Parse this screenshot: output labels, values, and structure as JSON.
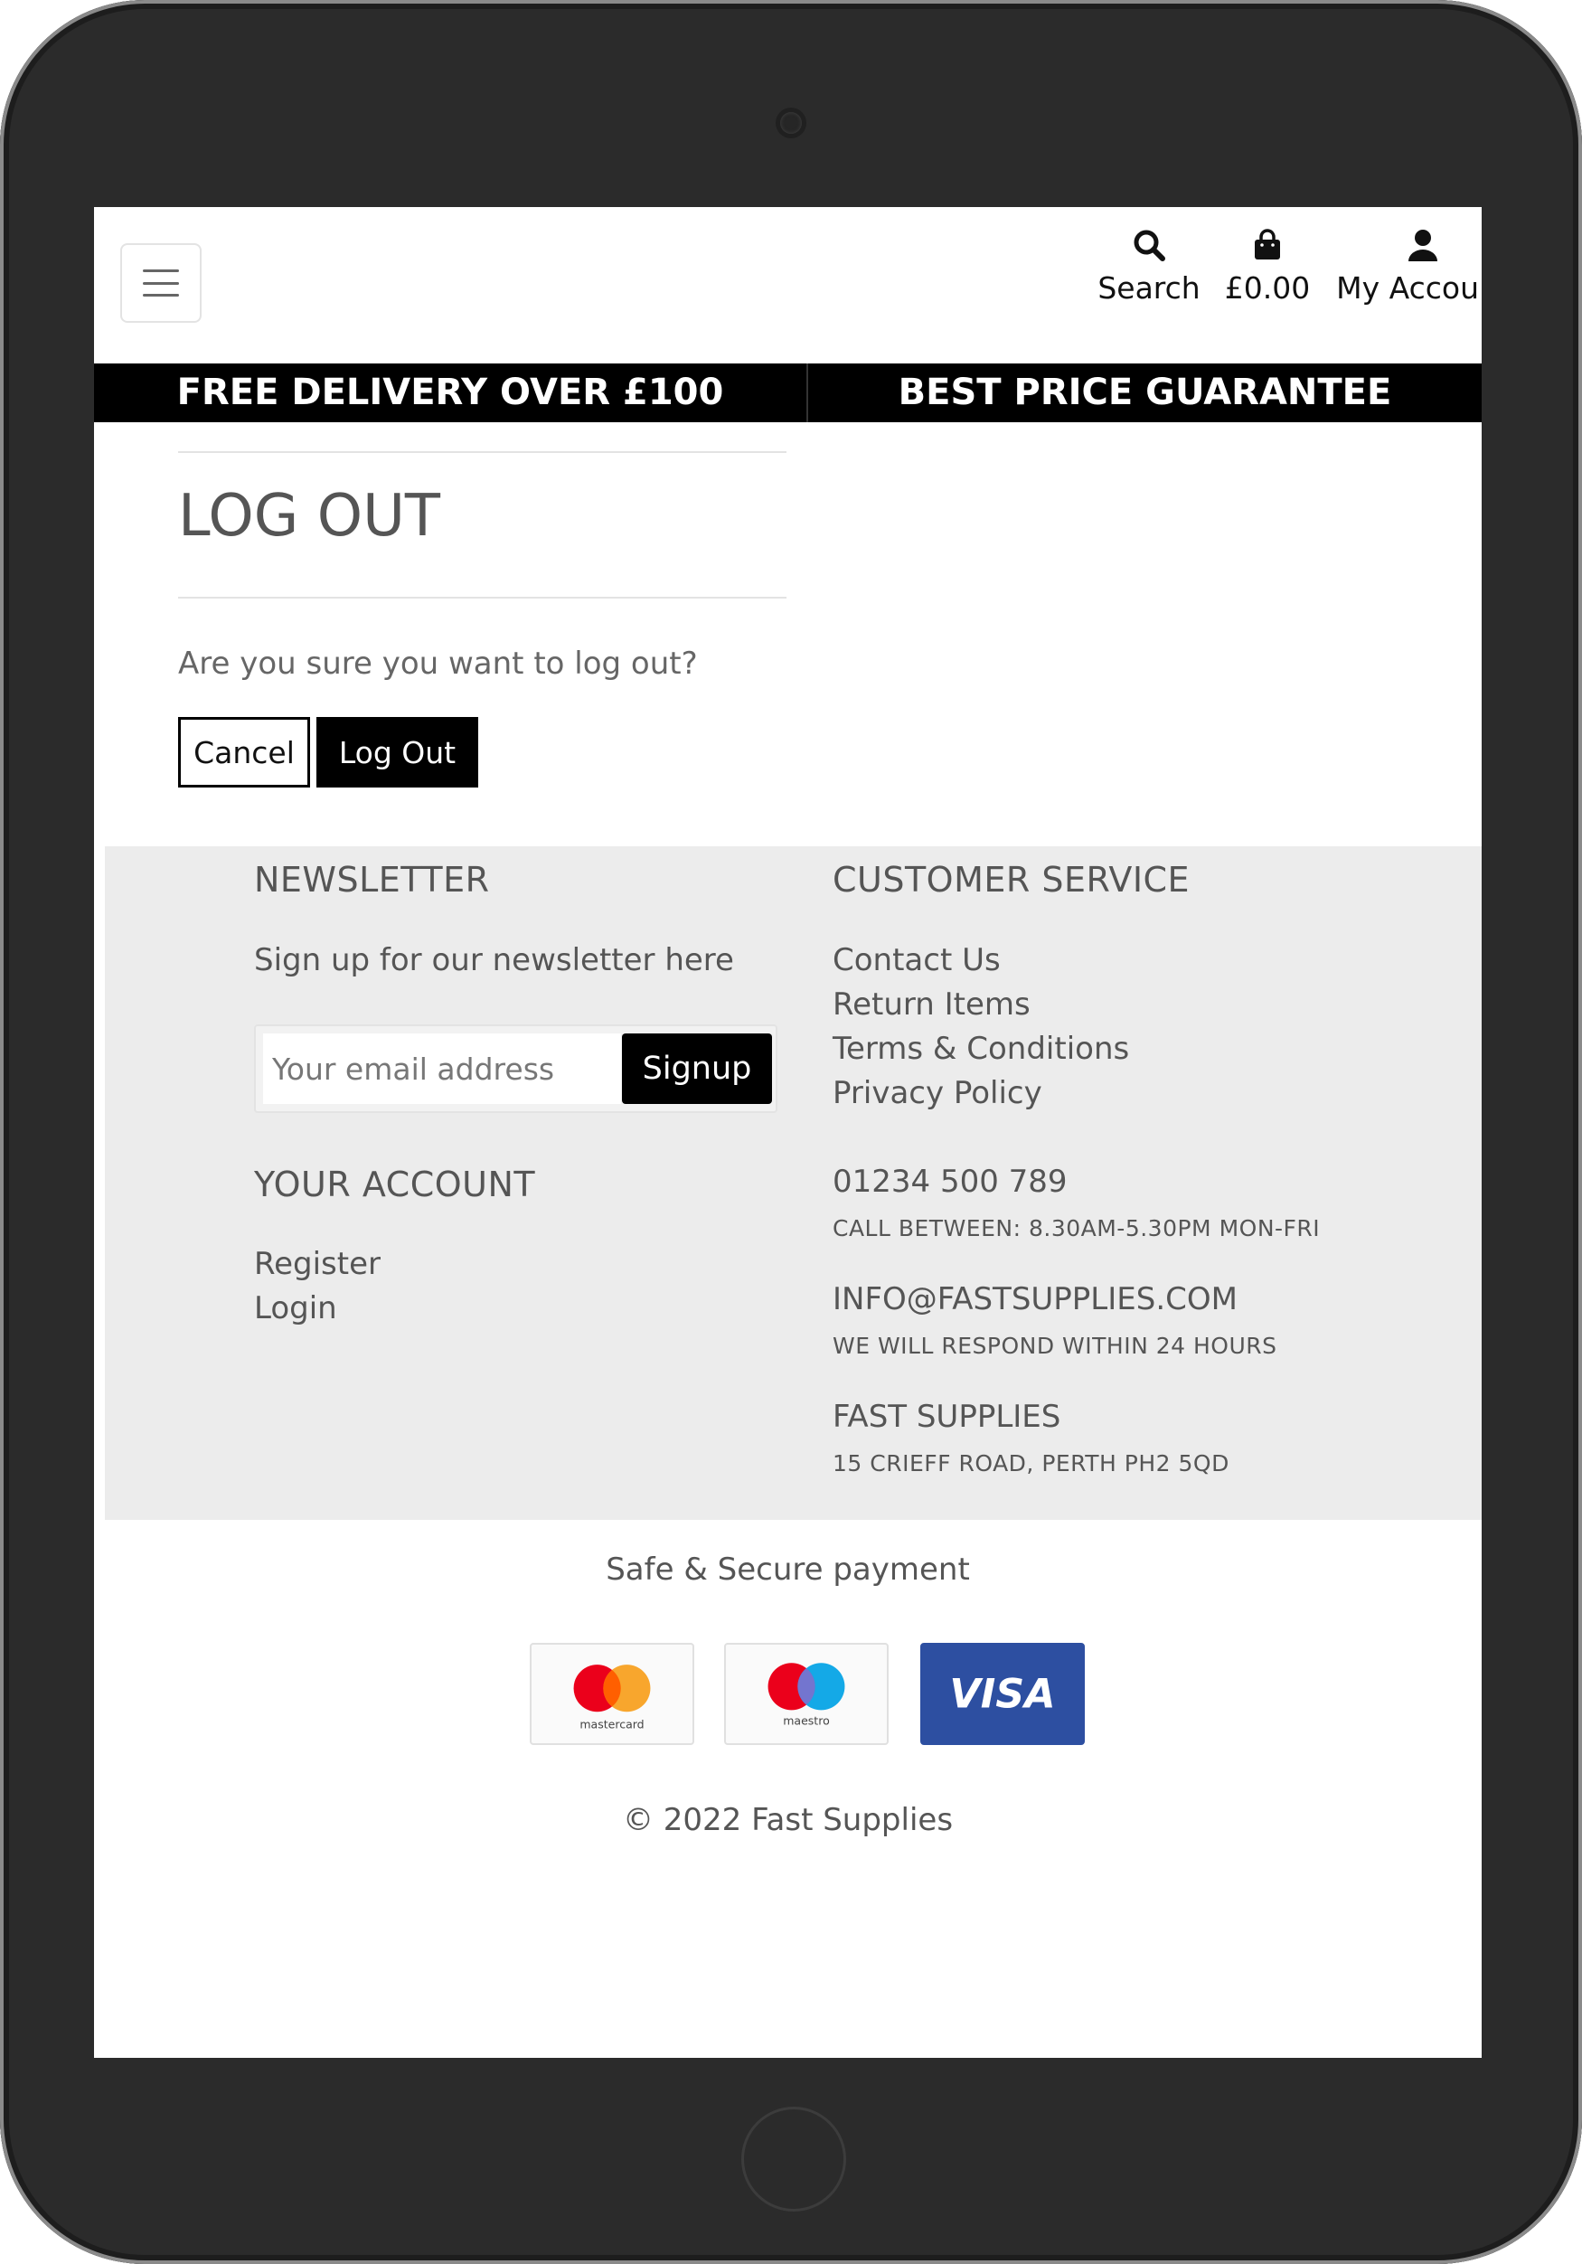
{
  "header": {
    "nav": {
      "search_label": "Search",
      "basket_total": "£0.00",
      "account_label": "My Account"
    },
    "icons": [
      "menu-icon",
      "search-icon",
      "shopping-bag-icon",
      "user-icon"
    ]
  },
  "promo": {
    "left": "FREE DELIVERY OVER £100",
    "right": "BEST PRICE GUARANTEE"
  },
  "logout": {
    "title": "LOG OUT",
    "question": "Are you sure you want to log out?",
    "cancel_label": "Cancel",
    "logout_label": "Log Out"
  },
  "footer": {
    "newsletter": {
      "heading": "NEWSLETTER",
      "text": "Sign up for our newsletter here",
      "email_placeholder": "Your email address",
      "signup_label": "Signup"
    },
    "account": {
      "heading": "YOUR ACCOUNT",
      "links": [
        "Register",
        "Login"
      ]
    },
    "customer_service": {
      "heading": "CUSTOMER SERVICE",
      "links": [
        "Contact Us",
        "Return Items",
        "Terms & Conditions",
        "Privacy Policy"
      ],
      "phone": "01234 500 789",
      "phone_note": "CALL BETWEEN: 8.30AM-5.30PM MON-FRI",
      "email": "INFO@FASTSUPPLIES.COM",
      "email_note": "WE WILL RESPOND WITHIN 24 HOURS",
      "company": "FAST SUPPLIES",
      "address": "15 CRIEFF ROAD, PERTH PH2 5QD"
    }
  },
  "payments": {
    "heading": "Safe & Secure payment",
    "cards": [
      "mastercard",
      "maestro",
      "VISA"
    ]
  },
  "copyright": "© 2022 Fast Supplies",
  "colors": {
    "primary": "#000000",
    "footer_bg": "#ececec",
    "text": "#555555",
    "visa_blue": "#2d4fa1",
    "mc_red": "#eb001b",
    "mc_orange": "#f79e1b",
    "maestro_blue": "#00a2e5"
  }
}
